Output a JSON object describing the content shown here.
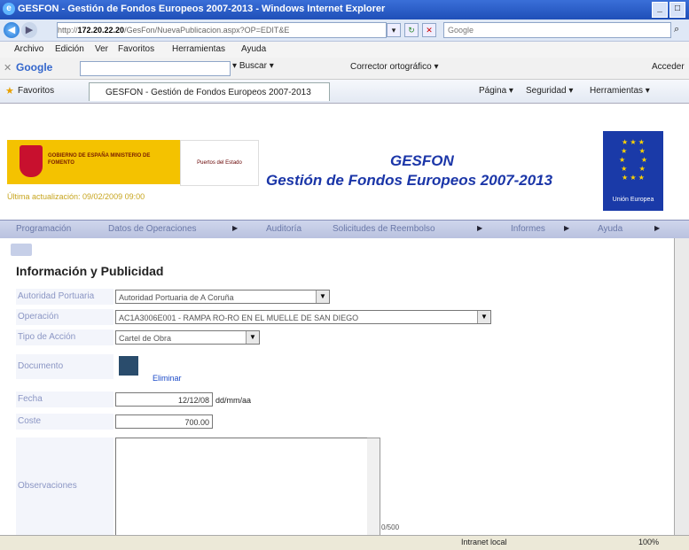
{
  "window": {
    "title": "GESFON - Gestión de Fondos Europeos 2007-2013 - Windows Internet Explorer"
  },
  "address": {
    "prefix": "http://",
    "host": "172.20.22.20",
    "path": "/GesFon/NuevaPublicacion.aspx?OP=EDIT&E"
  },
  "search": {
    "placeholder": "Google"
  },
  "menubar": {
    "items": [
      "Archivo",
      "Edición",
      "Ver",
      "Favoritos",
      "Herramientas",
      "Ayuda"
    ]
  },
  "googlebar": {
    "brand": "Google",
    "buscar": "Buscar",
    "corrector": "Corrector ortográfico",
    "acceder": "Acceder"
  },
  "favbar": {
    "favoritos": "Favoritos",
    "tab": "GESFON - Gestión de Fondos Europeos 2007-2013",
    "pagina": "Página",
    "seguridad": "Seguridad",
    "herramientas": "Herramientas"
  },
  "header": {
    "gov_text": "GOBIERNO DE ESPAÑA   MINISTERIO DE FOMENTO",
    "port_text": "Puertos del Estado",
    "title": "GESFON",
    "subtitle": "Gestión de Fondos Europeos 2007-2013",
    "update": "Última actualización: 09/02/2009 09:00",
    "eu_text": "Unión Europea"
  },
  "nav": {
    "items": [
      "Programación",
      "Datos de Operaciones",
      "Auditoría",
      "Solicitudes de Reembolso",
      "Informes",
      "Ayuda"
    ]
  },
  "form": {
    "title": "Información y Publicidad",
    "autoridad_label": "Autoridad Portuaria",
    "autoridad_value": "Autoridad Portuaria de A Coruña",
    "operacion_label": "Operación",
    "operacion_value": "AC1A3006E001 - RAMPA RO-RO EN EL MUELLE DE SAN DIEGO",
    "tipo_label": "Tipo de Acción",
    "tipo_value": "Cartel de Obra",
    "documento_label": "Documento",
    "eliminar": "Eliminar",
    "fecha_label": "Fecha",
    "fecha_value": "12/12/08",
    "fecha_format": "dd/mm/aa",
    "coste_label": "Coste",
    "coste_value": "700.00",
    "obs_label": "Observaciones",
    "obs_counter": "0/500"
  },
  "status": {
    "zone": "Intranet local",
    "zoom": "100%"
  }
}
